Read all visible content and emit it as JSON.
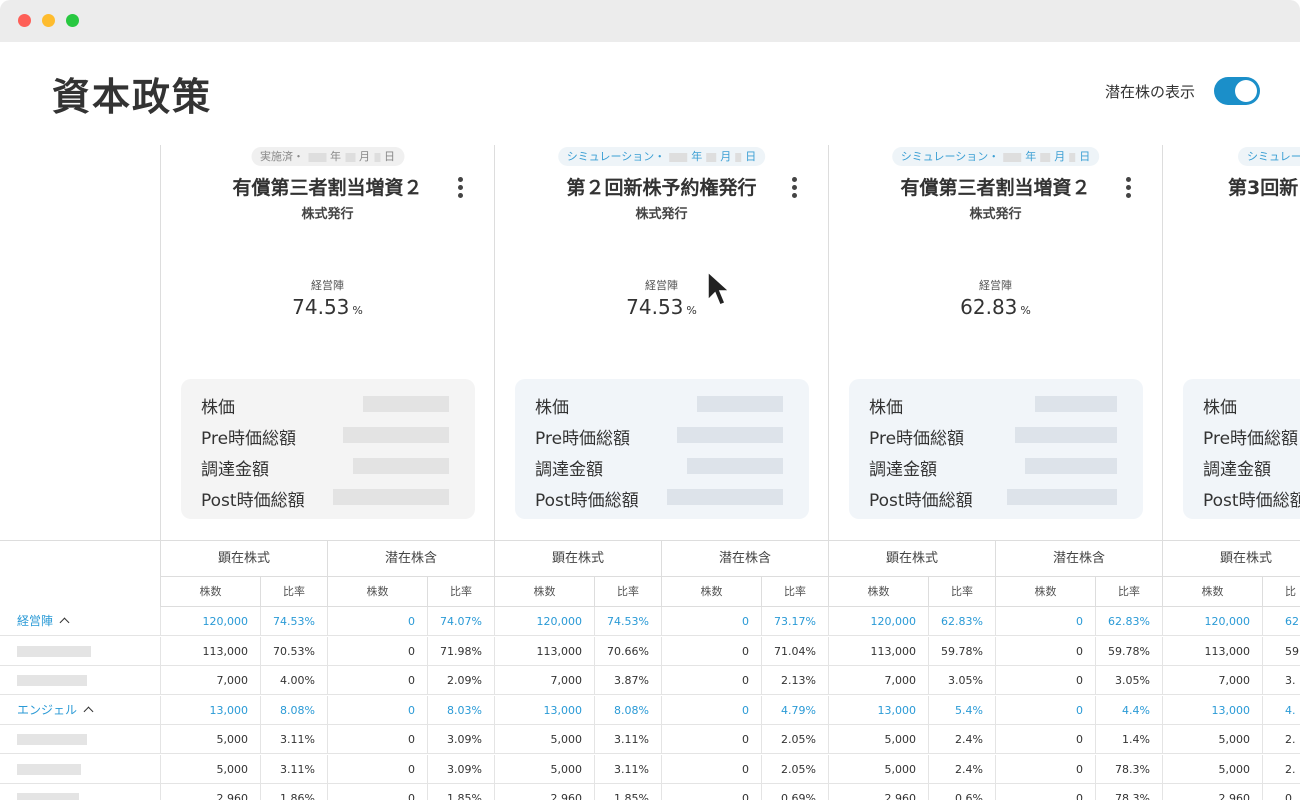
{
  "window": {
    "controls": [
      "close",
      "minimize",
      "zoom"
    ]
  },
  "page": {
    "title": "資本政策",
    "toggle_label": "潜在株の表示",
    "toggle_on": true
  },
  "columns": [
    {
      "tag": {
        "prefix": "実施済・",
        "year": "年",
        "month": "月",
        "day": "日",
        "kind": "done"
      },
      "title": "有償第三者割当増資２",
      "subtitle": "株式発行",
      "metric_label": "経営陣",
      "metric_value": "74.53",
      "metric_unit": "%",
      "card_labels": [
        "株価",
        "Pre時価総額",
        "調達金額",
        "Post時価総額"
      ],
      "table_headers": [
        "顕在株式",
        "潜在株含"
      ],
      "sub_headers": [
        "株数",
        "比率",
        "株数",
        "比率"
      ]
    },
    {
      "tag": {
        "prefix": "シミュレーション・",
        "year": "年",
        "month": "月",
        "day": "日",
        "kind": "sim"
      },
      "title": "第２回新株予約権発行",
      "subtitle": "株式発行",
      "metric_label": "経営陣",
      "metric_value": "74.53",
      "metric_unit": "%",
      "card_labels": [
        "株価",
        "Pre時価総額",
        "調達金額",
        "Post時価総額"
      ],
      "table_headers": [
        "顕在株式",
        "潜在株含"
      ],
      "sub_headers": [
        "株数",
        "比率",
        "株数",
        "比率"
      ]
    },
    {
      "tag": {
        "prefix": "シミュレーション・",
        "year": "年",
        "month": "月",
        "day": "日",
        "kind": "sim"
      },
      "title": "有償第三者割当増資２",
      "subtitle": "株式発行",
      "metric_label": "経営陣",
      "metric_value": "62.83",
      "metric_unit": "%",
      "card_labels": [
        "株価",
        "Pre時価総額",
        "調達金額",
        "Post時価総額"
      ],
      "table_headers": [
        "顕在株式",
        "潜在株含"
      ],
      "sub_headers": [
        "株数",
        "比率",
        "株数",
        "比率"
      ]
    },
    {
      "tag": {
        "prefix": "シミュレー",
        "kind": "sim"
      },
      "title": "第3回新",
      "card_labels": [
        "株価",
        "Pre時価総額",
        "調達金額",
        "Post時価総額"
      ],
      "table_headers": [
        "顕在株式"
      ],
      "sub_headers": [
        "株数",
        "比"
      ]
    }
  ],
  "rows": [
    {
      "label": "経営陣",
      "group": true,
      "expanded": true,
      "values": [
        [
          "120,000",
          "74.53%",
          "0",
          "74.07%"
        ],
        [
          "120,000",
          "74.53%",
          "0",
          "73.17%"
        ],
        [
          "120,000",
          "62.83%",
          "0",
          "62.83%"
        ],
        [
          "120,000",
          "62."
        ]
      ]
    },
    {
      "label": "",
      "group": false,
      "values": [
        [
          "113,000",
          "70.53%",
          "0",
          "71.98%"
        ],
        [
          "113,000",
          "70.66%",
          "0",
          "71.04%"
        ],
        [
          "113,000",
          "59.78%",
          "0",
          "59.78%"
        ],
        [
          "113,000",
          "59."
        ]
      ]
    },
    {
      "label": "",
      "group": false,
      "values": [
        [
          "7,000",
          "4.00%",
          "0",
          "2.09%"
        ],
        [
          "7,000",
          "3.87%",
          "0",
          "2.13%"
        ],
        [
          "7,000",
          "3.05%",
          "0",
          "3.05%"
        ],
        [
          "7,000",
          "3."
        ]
      ]
    },
    {
      "label": "エンジェル",
      "group": true,
      "expanded": true,
      "values": [
        [
          "13,000",
          "8.08%",
          "0",
          "8.03%"
        ],
        [
          "13,000",
          "8.08%",
          "0",
          "4.79%"
        ],
        [
          "13,000",
          "5.4%",
          "0",
          "4.4%"
        ],
        [
          "13,000",
          "4."
        ]
      ]
    },
    {
      "label": "",
      "group": false,
      "values": [
        [
          "5,000",
          "3.11%",
          "0",
          "3.09%"
        ],
        [
          "5,000",
          "3.11%",
          "0",
          "2.05%"
        ],
        [
          "5,000",
          "2.4%",
          "0",
          "1.4%"
        ],
        [
          "5,000",
          "2."
        ]
      ]
    },
    {
      "label": "",
      "group": false,
      "values": [
        [
          "5,000",
          "3.11%",
          "0",
          "3.09%"
        ],
        [
          "5,000",
          "3.11%",
          "0",
          "2.05%"
        ],
        [
          "5,000",
          "2.4%",
          "0",
          "78.3%"
        ],
        [
          "5,000",
          "2."
        ]
      ]
    },
    {
      "label": "",
      "group": false,
      "values": [
        [
          "2,960",
          "1.86%",
          "0",
          "1.85%"
        ],
        [
          "2,960",
          "1.85%",
          "0",
          "0.69%"
        ],
        [
          "2,960",
          "0.6%",
          "0",
          "78.3%"
        ],
        [
          "2,960",
          "0."
        ]
      ]
    }
  ],
  "colors": {
    "accent": "#1b8fc9",
    "link_blue": "#2a9ad6",
    "card_bg": "#f4f4f4"
  }
}
